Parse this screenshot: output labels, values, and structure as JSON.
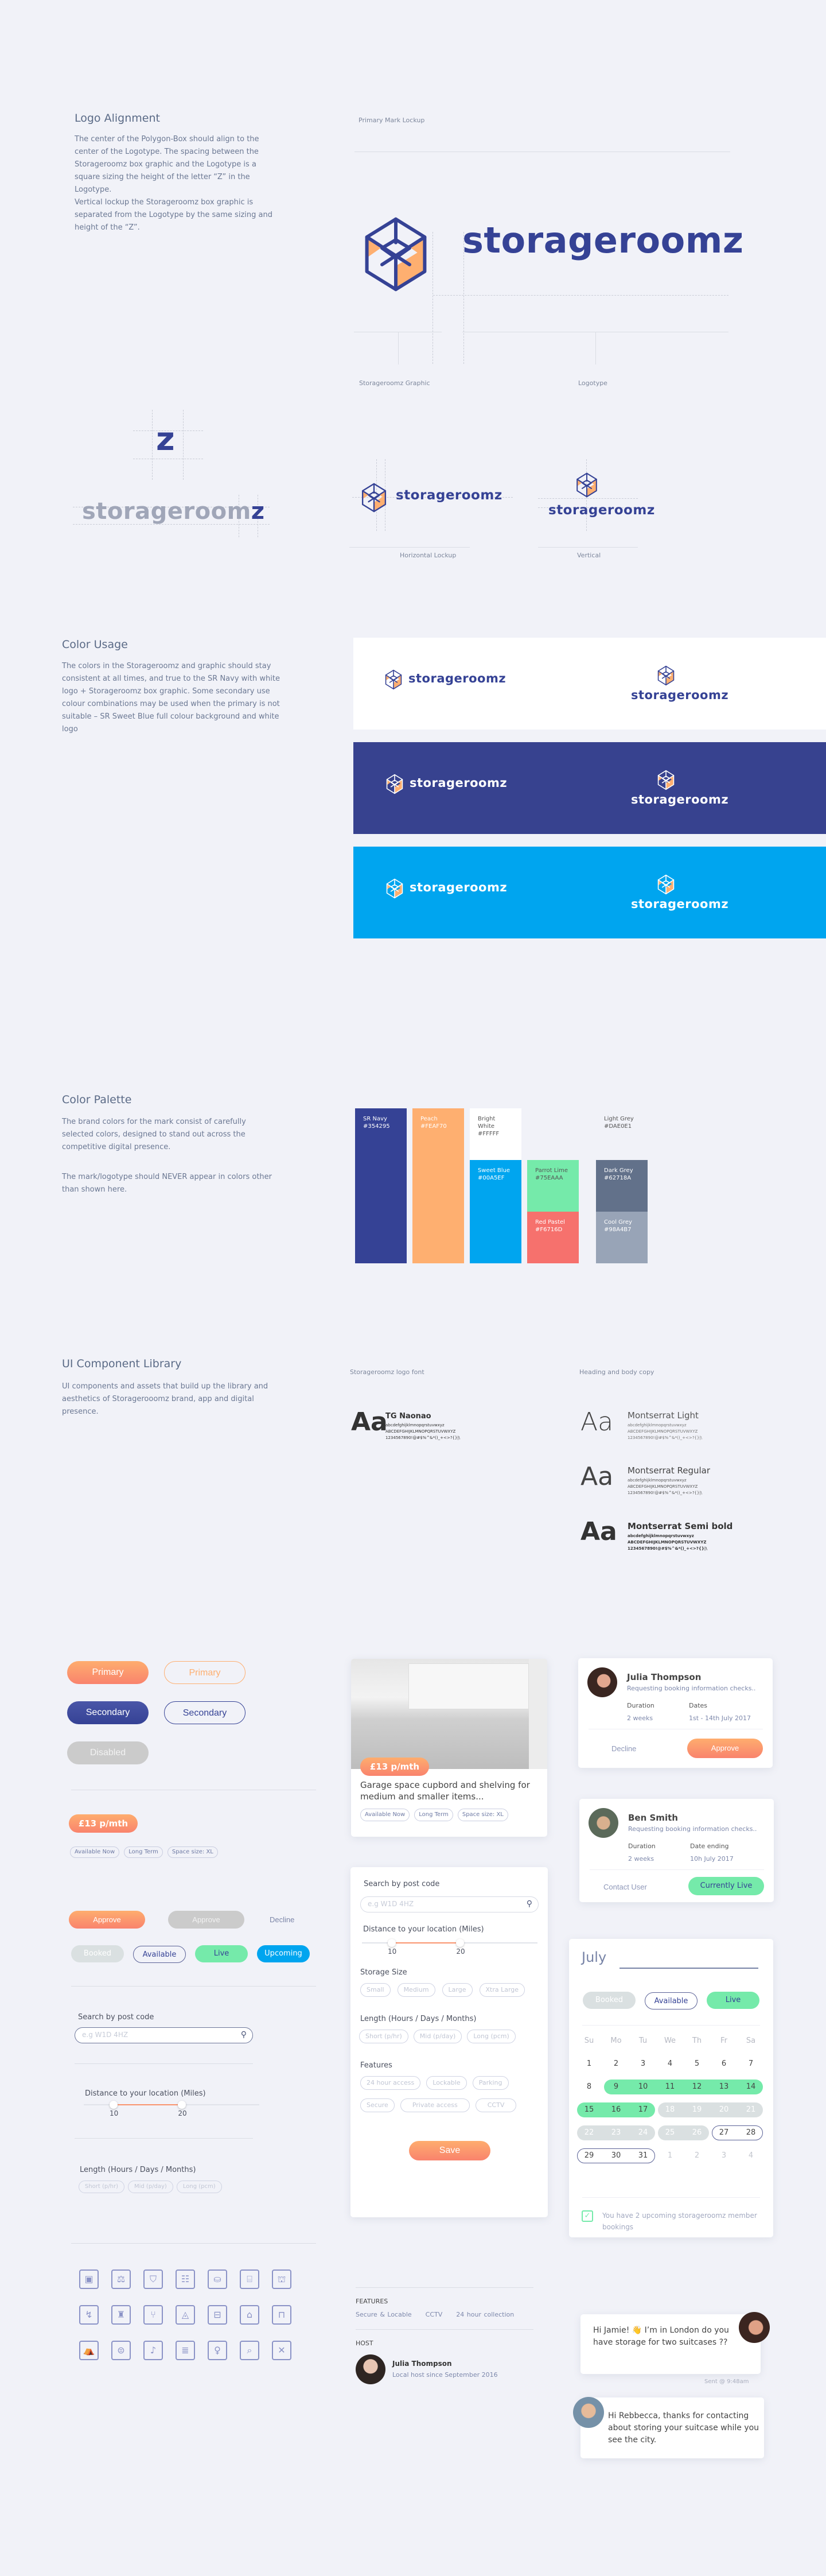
{
  "brand": {
    "name": "storageroomz",
    "letter_z": "z",
    "colors": {
      "navy": "#354295",
      "peach": "#FEAF70",
      "white": "#FFFFFF",
      "sweet_blue": "#00A5EF",
      "lime": "#75EAAA",
      "red": "#F6716D",
      "light_grey": "#DAE0E1",
      "dark_grey": "#62718A",
      "cool_grey": "#98A4B7",
      "bg": "#F1F2F8"
    }
  },
  "logo_alignment": {
    "title": "Logo Alignment",
    "body": "The center of the Polygon-Box should align to the center of the  Logotype. The spacing between the Storageroomz box graphic and the Logotype is a square sizing the height of the letter “Z” in the Logotype.",
    "body2": "Vertical lockup the Storageroomz box graphic is separated from the Logotype by the same sizing and height of the “Z”.",
    "primary_label": "Primary Mark Lockup",
    "graphic_label": "Storageroomz Graphic",
    "logotype_label": "Logotype",
    "horizontal_label": "Horizontal Lockup",
    "vertical_label": "Vertical"
  },
  "color_usage": {
    "title": "Color Usage",
    "body": "The colors in the Storageroomz and graphic should stay consistent at all times, and true to the SR Navy with white logo + Storageroomz box graphic. Some secondary use colour combinations may be used when the primary is not suitable – SR Sweet Blue full colour background and white logo"
  },
  "color_palette": {
    "title": "Color Palette",
    "body": "The brand colors for the mark consist of carefully selected colors, designed to stand out across the competitive digital presence.",
    "body2": "The mark/logotype should NEVER appear in colors other than shown here.",
    "swatches": [
      {
        "name": "SR Navy",
        "hex": "#354295"
      },
      {
        "name": "Peach",
        "hex": "#FEAF70"
      },
      {
        "name": "Bright White",
        "hex": "#FFFFF"
      },
      {
        "name": "Sweet Blue",
        "hex": "#00A5EF"
      },
      {
        "name": "Parrot Lime",
        "hex": "#75EAAA"
      },
      {
        "name": "Red Pastel",
        "hex": "#F6716D"
      },
      {
        "name": "Light Grey",
        "hex": "#DAE0E1"
      },
      {
        "name": "Dark Grey",
        "hex": "#62718A"
      },
      {
        "name": "Cool Grey",
        "hex": "#98A4B7"
      }
    ]
  },
  "ui_library": {
    "title": "UI Component Library",
    "body": "UI components and assets that build up the library and aesthetics of Storagerooomz brand, app and digital presence.",
    "logo_font_label": "Storageroomz logo font",
    "heading_font_label": "Heading and body copy",
    "sample_aa": "Aa",
    "lower": "abcdefghijklmnopqrstuvwxyz",
    "upper": "ABCDEFGHIJKLMNOPQRSTUVWXYZ",
    "symbols": "1234567890!@#$%^&*()_+<>?{}|\\",
    "fonts": {
      "logo": "TG  Naonao",
      "light": "Montserrat Light",
      "regular": "Montserrat Regular",
      "semibold": "Montserrat Semi bold"
    }
  },
  "buttons": {
    "primary": "Primary",
    "secondary": "Secondary",
    "disabled": "Disabled",
    "price": "£13 p/mth",
    "approve": "Approve",
    "decline": "Decline"
  },
  "tags": [
    "Available Now",
    "Long Term",
    "Space size: XL"
  ],
  "statuses": {
    "booked": "Booked",
    "available": "Available",
    "live": "Live",
    "upcoming": "Upcoming"
  },
  "search": {
    "label": "Search by post code",
    "placeholder": "e.g W1D 4HZ"
  },
  "distance": {
    "label": "Distance to your location (Miles)",
    "min": "10",
    "max": "20",
    "range_start_pct": 17,
    "range_end_pct": 56
  },
  "length": {
    "label": "Length (Hours / Days / Months)",
    "options": [
      "Short (p/hr)",
      "Mid (p/day)",
      "Long (pcm)"
    ]
  },
  "storage_size": {
    "label": "Storage Size",
    "options": [
      "Small",
      "Medium",
      "Large",
      "Xtra Large"
    ]
  },
  "features": {
    "label": "Features",
    "options": [
      "24 hour access",
      "Lockable",
      "Parking",
      "Secure",
      "Private access",
      "CCTV"
    ]
  },
  "save": "Save",
  "listing": {
    "price": "£13 p/mth",
    "title": "Garage space cupbord and shelving for medium and smaller items..."
  },
  "detail": {
    "features_label": "FEATURES",
    "features": [
      "Secure & Locable",
      "CCTV",
      "24 hour collection"
    ],
    "host_label": "HOST",
    "host_name": "Julia Thompson",
    "host_since": "Local host since September 2016"
  },
  "requests": [
    {
      "name": "Julia Thompson",
      "sub": "Requesting booking information checks..",
      "k1": "Duration",
      "v1": "2 weeks",
      "k2": "Dates",
      "v2": "1st - 14th July 2017",
      "left": "Decline",
      "right": "Approve"
    },
    {
      "name": "Ben Smith",
      "sub": "Requesting booking information checks..",
      "k1": "Duration",
      "v1": "2 weeks",
      "k2": "Date ending",
      "v2": "10h July 2017",
      "left": "Contact User",
      "right": "Currently Live"
    }
  ],
  "calendar": {
    "month": "July",
    "days": [
      "Su",
      "Mo",
      "Tu",
      "We",
      "Th",
      "Fr",
      "Sa"
    ],
    "weeks": [
      [
        "1",
        "2",
        "3",
        "4",
        "5",
        "6",
        "7"
      ],
      [
        "8",
        "9",
        "10",
        "11",
        "12",
        "13",
        "14"
      ],
      [
        "15",
        "16",
        "17",
        "18",
        "19",
        "20",
        "21"
      ],
      [
        "22",
        "23",
        "24",
        "25",
        "26",
        "27",
        "28"
      ],
      [
        "29",
        "30",
        "31",
        "1",
        "2",
        "3",
        "4"
      ]
    ],
    "notice": "You have 2 upcoming storageroomz member bookings"
  },
  "chat": {
    "msg1": "Hi Jamie! 👋 I’m in London do you have storage for two suitcases ??",
    "sent": "Sent @ 9:48am",
    "msg2": "Hi Rebbecca, thanks for contacting about storing your suitcase while you see the city."
  },
  "icons": [
    "picture-frame",
    "dumbbell",
    "jacket",
    "drawers",
    "barrel",
    "cash-register",
    "cooking-pot",
    "boomerang",
    "lamp",
    "chair",
    "slide",
    "bed",
    "armchair",
    "swing",
    "tent",
    "drum",
    "guitar",
    "bunk-bed",
    "dress",
    "telescope",
    "hockey-sticks"
  ]
}
